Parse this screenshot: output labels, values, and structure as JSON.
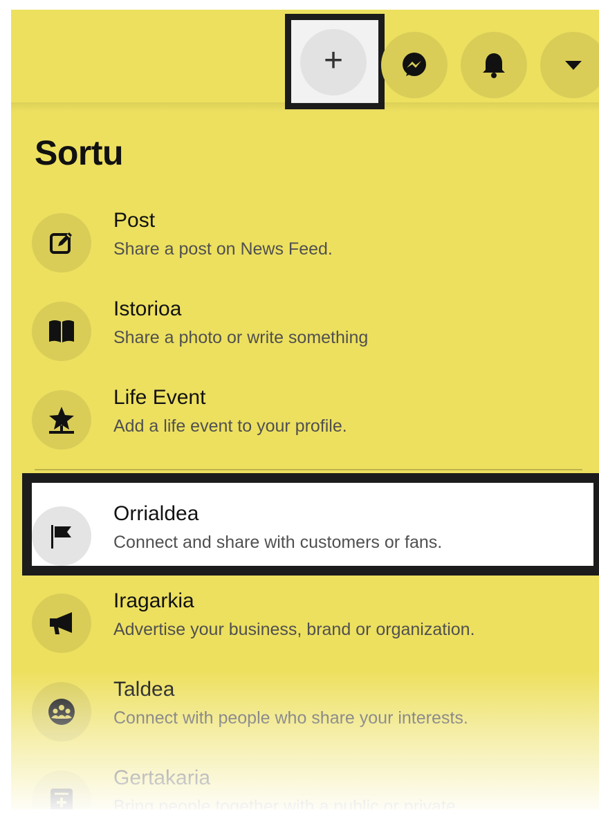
{
  "header": {
    "create_icon": "plus-icon",
    "buttons": [
      "messenger-icon",
      "bell-icon",
      "caret-down-icon"
    ]
  },
  "menu": {
    "title": "Sortu",
    "items": [
      {
        "label": "Post",
        "description": "Share a post on News Feed.",
        "icon": "edit-icon"
      },
      {
        "label": "Istorioa",
        "description": "Share a photo or write something",
        "icon": "book-icon"
      },
      {
        "label": "Life Event",
        "description": "Add a life event to your profile.",
        "icon": "star-icon"
      },
      {
        "label": "Orrialdea",
        "description": "Connect and share with customers or fans.",
        "icon": "flag-icon"
      },
      {
        "label": "Iragarkia",
        "description": "Advertise your business, brand or organization.",
        "icon": "megaphone-icon"
      },
      {
        "label": "Taldea",
        "description": "Connect with people who share your interests.",
        "icon": "group-icon"
      },
      {
        "label": "Gertakaria",
        "description": "Bring people together with a public or private",
        "icon": "calendar-plus-icon"
      }
    ]
  },
  "colors": {
    "background": "#ede05f",
    "icon_circle": "#d9cd58",
    "highlight_border": "#1c1c1c"
  }
}
